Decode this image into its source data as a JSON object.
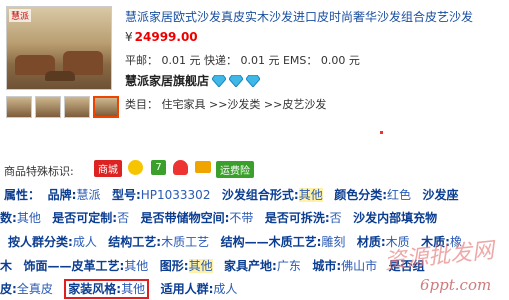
{
  "product": {
    "logo": "慧派",
    "title": "慧派家居欧式沙发真皮实木沙发进口皮时尚奢华沙发组合皮艺沙发",
    "currency": "¥",
    "price": "24999.00",
    "shipping": "平邮： 0.01 元 快递： 0.01 元 EMS： 0.00 元",
    "store_name": "慧派家居旗舰店",
    "diamond_count": 3,
    "category": "类目： 住宅家具 >>沙发类 >>皮艺沙发"
  },
  "badges": {
    "label": "商品特殊标识:",
    "mall": "商城",
    "shipping_insurance": "运费险",
    "icons": [
      "thumbs-up-icon",
      "number-7-icon",
      "heart-icon",
      "card-icon"
    ]
  },
  "attributes": {
    "row1": [
      {
        "k": "属性：",
        "v": ""
      },
      {
        "k": "品牌:",
        "v": "慧派"
      },
      {
        "k": "型号:",
        "v": "HP1033302"
      },
      {
        "k": "沙发组合形式:",
        "v": "其他"
      },
      {
        "k": "颜色分类:",
        "v": "红色"
      },
      {
        "k": "沙发座",
        "v": ""
      }
    ],
    "row2": [
      {
        "k": "数:",
        "v": "其他"
      },
      {
        "k": "是否可定制:",
        "v": "否"
      },
      {
        "k": "是否带储物空间:",
        "v": "不带"
      },
      {
        "k": "是否可拆洗:",
        "v": "否"
      },
      {
        "k": "沙发内部填充物",
        "v": ""
      }
    ],
    "row3": [
      {
        "k": "按人群分类:",
        "v": "成人"
      },
      {
        "k": "结构工艺:",
        "v": "木质工艺"
      },
      {
        "k": "结构——木质工艺:",
        "v": "雕刻"
      },
      {
        "k": "材质:",
        "v": "木质"
      },
      {
        "k": "木质:",
        "v": "橡"
      }
    ],
    "row4": [
      {
        "k": "木",
        "v": ""
      },
      {
        "k": "饰面——皮革工艺:",
        "v": "其他"
      },
      {
        "k": "图形:",
        "v": "其他"
      },
      {
        "k": "家具产地:",
        "v": "广东"
      },
      {
        "k": "城市:",
        "v": "佛山市"
      },
      {
        "k": "是否组",
        "v": ""
      }
    ],
    "row5": [
      {
        "k": "皮:",
        "v": "全真皮"
      },
      {
        "k": "家装风格:",
        "v": "其他"
      },
      {
        "k": "适用人群:",
        "v": "成人"
      }
    ]
  },
  "watermark": {
    "text": "资源批发网",
    "domain": "6ppt.com"
  }
}
